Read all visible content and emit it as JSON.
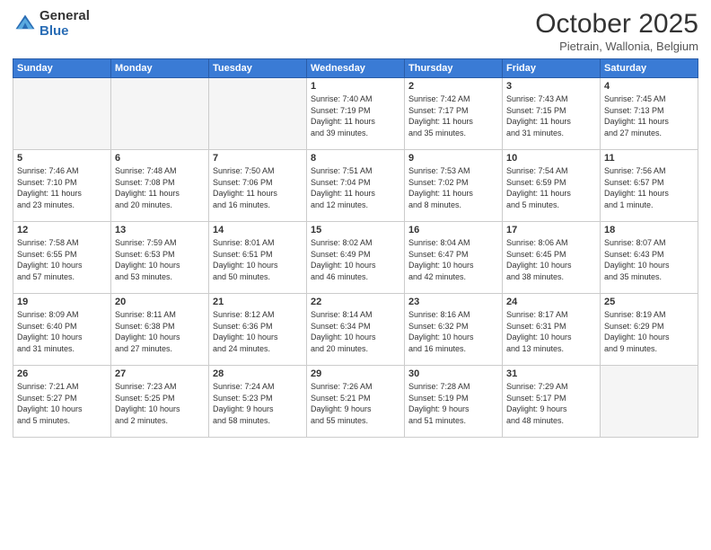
{
  "header": {
    "logo_general": "General",
    "logo_blue": "Blue",
    "month_title": "October 2025",
    "location": "Pietrain, Wallonia, Belgium"
  },
  "weekdays": [
    "Sunday",
    "Monday",
    "Tuesday",
    "Wednesday",
    "Thursday",
    "Friday",
    "Saturday"
  ],
  "weeks": [
    [
      {
        "num": "",
        "info": ""
      },
      {
        "num": "",
        "info": ""
      },
      {
        "num": "",
        "info": ""
      },
      {
        "num": "1",
        "info": "Sunrise: 7:40 AM\nSunset: 7:19 PM\nDaylight: 11 hours\nand 39 minutes."
      },
      {
        "num": "2",
        "info": "Sunrise: 7:42 AM\nSunset: 7:17 PM\nDaylight: 11 hours\nand 35 minutes."
      },
      {
        "num": "3",
        "info": "Sunrise: 7:43 AM\nSunset: 7:15 PM\nDaylight: 11 hours\nand 31 minutes."
      },
      {
        "num": "4",
        "info": "Sunrise: 7:45 AM\nSunset: 7:13 PM\nDaylight: 11 hours\nand 27 minutes."
      }
    ],
    [
      {
        "num": "5",
        "info": "Sunrise: 7:46 AM\nSunset: 7:10 PM\nDaylight: 11 hours\nand 23 minutes."
      },
      {
        "num": "6",
        "info": "Sunrise: 7:48 AM\nSunset: 7:08 PM\nDaylight: 11 hours\nand 20 minutes."
      },
      {
        "num": "7",
        "info": "Sunrise: 7:50 AM\nSunset: 7:06 PM\nDaylight: 11 hours\nand 16 minutes."
      },
      {
        "num": "8",
        "info": "Sunrise: 7:51 AM\nSunset: 7:04 PM\nDaylight: 11 hours\nand 12 minutes."
      },
      {
        "num": "9",
        "info": "Sunrise: 7:53 AM\nSunset: 7:02 PM\nDaylight: 11 hours\nand 8 minutes."
      },
      {
        "num": "10",
        "info": "Sunrise: 7:54 AM\nSunset: 6:59 PM\nDaylight: 11 hours\nand 5 minutes."
      },
      {
        "num": "11",
        "info": "Sunrise: 7:56 AM\nSunset: 6:57 PM\nDaylight: 11 hours\nand 1 minute."
      }
    ],
    [
      {
        "num": "12",
        "info": "Sunrise: 7:58 AM\nSunset: 6:55 PM\nDaylight: 10 hours\nand 57 minutes."
      },
      {
        "num": "13",
        "info": "Sunrise: 7:59 AM\nSunset: 6:53 PM\nDaylight: 10 hours\nand 53 minutes."
      },
      {
        "num": "14",
        "info": "Sunrise: 8:01 AM\nSunset: 6:51 PM\nDaylight: 10 hours\nand 50 minutes."
      },
      {
        "num": "15",
        "info": "Sunrise: 8:02 AM\nSunset: 6:49 PM\nDaylight: 10 hours\nand 46 minutes."
      },
      {
        "num": "16",
        "info": "Sunrise: 8:04 AM\nSunset: 6:47 PM\nDaylight: 10 hours\nand 42 minutes."
      },
      {
        "num": "17",
        "info": "Sunrise: 8:06 AM\nSunset: 6:45 PM\nDaylight: 10 hours\nand 38 minutes."
      },
      {
        "num": "18",
        "info": "Sunrise: 8:07 AM\nSunset: 6:43 PM\nDaylight: 10 hours\nand 35 minutes."
      }
    ],
    [
      {
        "num": "19",
        "info": "Sunrise: 8:09 AM\nSunset: 6:40 PM\nDaylight: 10 hours\nand 31 minutes."
      },
      {
        "num": "20",
        "info": "Sunrise: 8:11 AM\nSunset: 6:38 PM\nDaylight: 10 hours\nand 27 minutes."
      },
      {
        "num": "21",
        "info": "Sunrise: 8:12 AM\nSunset: 6:36 PM\nDaylight: 10 hours\nand 24 minutes."
      },
      {
        "num": "22",
        "info": "Sunrise: 8:14 AM\nSunset: 6:34 PM\nDaylight: 10 hours\nand 20 minutes."
      },
      {
        "num": "23",
        "info": "Sunrise: 8:16 AM\nSunset: 6:32 PM\nDaylight: 10 hours\nand 16 minutes."
      },
      {
        "num": "24",
        "info": "Sunrise: 8:17 AM\nSunset: 6:31 PM\nDaylight: 10 hours\nand 13 minutes."
      },
      {
        "num": "25",
        "info": "Sunrise: 8:19 AM\nSunset: 6:29 PM\nDaylight: 10 hours\nand 9 minutes."
      }
    ],
    [
      {
        "num": "26",
        "info": "Sunrise: 7:21 AM\nSunset: 5:27 PM\nDaylight: 10 hours\nand 5 minutes."
      },
      {
        "num": "27",
        "info": "Sunrise: 7:23 AM\nSunset: 5:25 PM\nDaylight: 10 hours\nand 2 minutes."
      },
      {
        "num": "28",
        "info": "Sunrise: 7:24 AM\nSunset: 5:23 PM\nDaylight: 9 hours\nand 58 minutes."
      },
      {
        "num": "29",
        "info": "Sunrise: 7:26 AM\nSunset: 5:21 PM\nDaylight: 9 hours\nand 55 minutes."
      },
      {
        "num": "30",
        "info": "Sunrise: 7:28 AM\nSunset: 5:19 PM\nDaylight: 9 hours\nand 51 minutes."
      },
      {
        "num": "31",
        "info": "Sunrise: 7:29 AM\nSunset: 5:17 PM\nDaylight: 9 hours\nand 48 minutes."
      },
      {
        "num": "",
        "info": ""
      }
    ]
  ]
}
